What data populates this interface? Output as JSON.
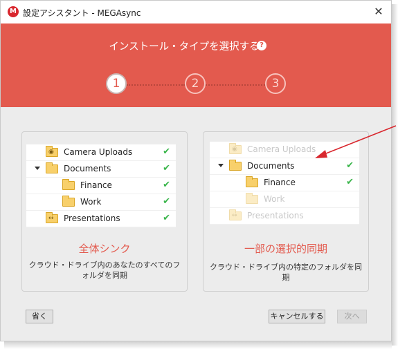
{
  "window": {
    "title": "設定アシスタント - MEGAsync",
    "close_glyph": "✕",
    "logo": "M"
  },
  "header": {
    "title": "インストール・タイプを選択する",
    "help_glyph": "?",
    "steps": [
      "1",
      "2",
      "3"
    ],
    "active_step": 1
  },
  "full_sync": {
    "title": "全体シンク",
    "description": "クラウド・ドライブ内のあなたのすべてのフォルダを同期",
    "items": [
      {
        "label": "Camera Uploads",
        "icon": "camera-folder-icon",
        "selected": true
      },
      {
        "label": "Documents",
        "icon": "folder-icon",
        "selected": true,
        "expanded": true
      },
      {
        "label": "Finance",
        "icon": "folder-icon",
        "selected": true
      },
      {
        "label": "Work",
        "icon": "folder-icon",
        "selected": true
      },
      {
        "label": "Presentations",
        "icon": "presentation-folder-icon",
        "selected": true
      }
    ]
  },
  "selective_sync": {
    "title": "一部の選択的同期",
    "description": "クラウド・ドライブ内の特定のフォルダを同期",
    "items": [
      {
        "label": "Camera Uploads",
        "icon": "camera-folder-icon",
        "selected": false
      },
      {
        "label": "Documents",
        "icon": "folder-icon",
        "selected": true,
        "expanded": true
      },
      {
        "label": "Finance",
        "icon": "folder-icon",
        "selected": true
      },
      {
        "label": "Work",
        "icon": "folder-icon",
        "selected": false
      },
      {
        "label": "Presentations",
        "icon": "presentation-folder-icon",
        "selected": false
      }
    ]
  },
  "check_glyph": "✔",
  "buttons": {
    "skip": "省く",
    "cancel": "キャンセルする",
    "next": "次へ"
  },
  "colors": {
    "accent": "#e35a4e",
    "check": "#39b54a",
    "annotation_arrow": "#d9272e"
  }
}
